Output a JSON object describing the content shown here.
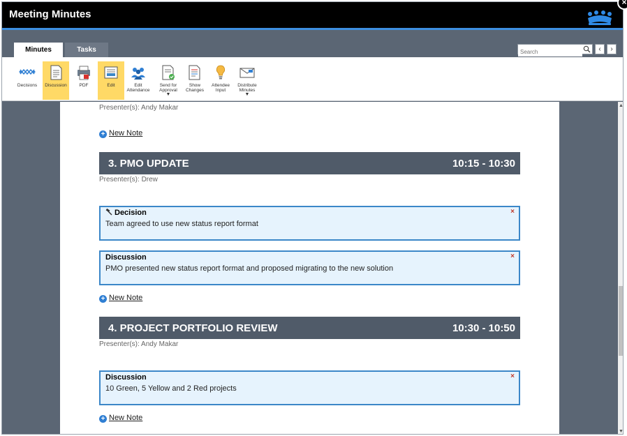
{
  "window": {
    "title": "Meeting Minutes",
    "close_label": "×"
  },
  "tabs": [
    {
      "label": "Minutes"
    },
    {
      "label": "Tasks"
    }
  ],
  "search": {
    "placeholder": "Search",
    "prev_label": "‹",
    "next_label": "›"
  },
  "toolbar": [
    {
      "label": "Decisions",
      "icon": "decisions-icon"
    },
    {
      "label": "Discussion",
      "icon": "discussion-icon",
      "active": true
    },
    {
      "label": "PDF",
      "icon": "pdf-icon"
    },
    {
      "label": "Edit",
      "icon": "edit-icon",
      "active": true
    },
    {
      "label": "Edit Attendance",
      "icon": "attendance-icon"
    },
    {
      "label": "Send for Approval",
      "icon": "approval-icon",
      "dropdown": true
    },
    {
      "label": "Show Changes",
      "icon": "changes-icon"
    },
    {
      "label": "Attendee Input",
      "icon": "lightbulb-icon"
    },
    {
      "label": "Distribute Minutes",
      "icon": "distribute-icon",
      "dropdown": true
    }
  ],
  "content": {
    "top_presenter": "Presenter(s): Andy Makar",
    "new_note_label": "New Note",
    "agenda": [
      {
        "title": "3. PMO UPDATE",
        "time": "10:15 - 10:30",
        "presenter": "Presenter(s): Drew",
        "notes": [
          {
            "type": "Decision",
            "text": "Team agreed to use new status report format"
          },
          {
            "type": "Discussion",
            "text": "PMO presented new status report format and proposed migrating to the new solution"
          }
        ]
      },
      {
        "title": "4. PROJECT PORTFOLIO REVIEW",
        "time": "10:30 - 10:50",
        "presenter": "Presenter(s): Andy Makar",
        "notes": [
          {
            "type": "Discussion",
            "text": "10 Green, 5 Yellow and 2 Red projects"
          }
        ]
      }
    ],
    "delete_label": "×"
  },
  "colors": {
    "accent": "#3d8fe0",
    "active_button": "#ffd966",
    "agenda_bar": "#505b69",
    "note_border": "#3b87c8",
    "note_bg": "#e6f3fd"
  }
}
